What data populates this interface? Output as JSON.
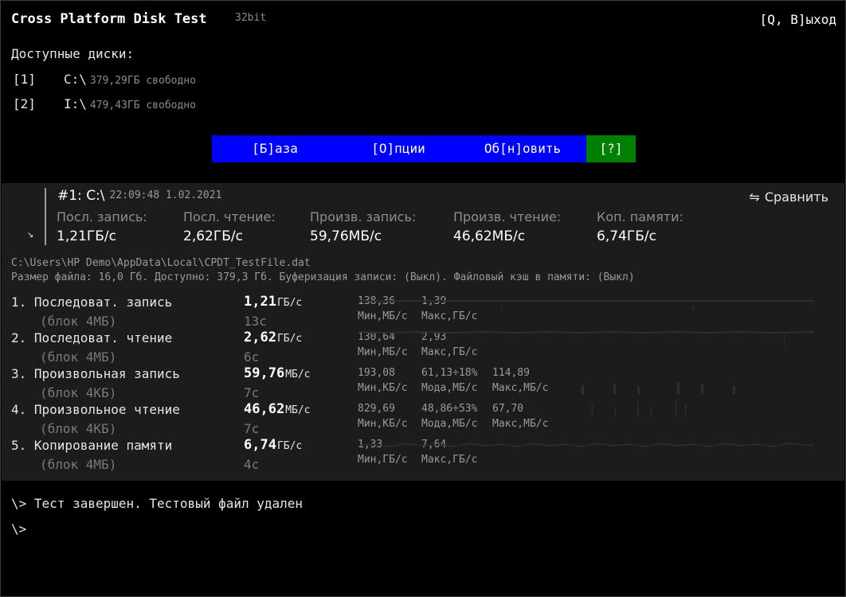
{
  "header": {
    "title": "Cross Platform Disk Test",
    "bits": "32bit",
    "quit": "[Q, В]ыход"
  },
  "disks": {
    "label": "Доступные диски:",
    "items": [
      {
        "key": "[1]",
        "drive": "C:\\",
        "free": "379,29ГБ свободно"
      },
      {
        "key": "[2]",
        "drive": "I:\\",
        "free": "479,43ГБ свободно"
      }
    ]
  },
  "menu": {
    "base": "[Б]аза",
    "options": "[О]пции",
    "update": "Об[н]овить",
    "help": "[?]"
  },
  "run": {
    "title": "#1: C:\\",
    "timestamp": "22:09:48 1.02.2021",
    "compare_icon": "swap-arrows-icon",
    "compare": "Сравнить",
    "arrow": "↘",
    "summary_headers": [
      "Посл. запись:",
      "Посл. чтение:",
      "Произв. запись:",
      "Произв. чтение:",
      "Коп. памяти:"
    ],
    "summary_values": [
      "1,21ГБ/с",
      "2,62ГБ/с",
      "59,76МБ/с",
      "46,62МБ/с",
      "6,74ГБ/с"
    ],
    "path": "C:\\Users\\HP Demo\\AppData\\Local\\CPDT_TestFile.dat",
    "info": "Размер файла: 16,0 Гб. Доступно: 379,3 Гб. Буферизация записи: (Выкл). Файловый кэш в памяти: (Выкл)"
  },
  "tests": [
    {
      "name": "1. Последоват. запись",
      "block": "(блок 4МБ)",
      "value": "1,21",
      "unit": "ГБ/с",
      "time": "13с",
      "stats_top": [
        "138,36",
        "1,39",
        ""
      ],
      "stats_bottom": [
        "Мин,МБ/с",
        "Макс,ГБ/с",
        ""
      ]
    },
    {
      "name": "2. Последоват. чтение",
      "block": "(блок 4МБ)",
      "value": "2,62",
      "unit": "ГБ/с",
      "time": "6с",
      "stats_top": [
        "130,64",
        "2,93",
        ""
      ],
      "stats_bottom": [
        "Мин,МБ/с",
        "Макс,ГБ/с",
        ""
      ]
    },
    {
      "name": "3. Произвольная запись",
      "block": "(блок 4КБ)",
      "value": "59,76",
      "unit": "МБ/с",
      "time": "7с",
      "stats_top": [
        "193,08",
        "61,13÷18%",
        "114,89"
      ],
      "stats_bottom": [
        "Мин,КБ/с",
        "Мода,МБ/с",
        "Макс,МБ/с"
      ]
    },
    {
      "name": "4. Произвольное чтение",
      "block": "(блок 4КБ)",
      "value": "46,62",
      "unit": "МБ/с",
      "time": "7с",
      "stats_top": [
        "829,69",
        "48,86÷53%",
        "67,70"
      ],
      "stats_bottom": [
        "Мин,КБ/с",
        "Мода,МБ/с",
        "Макс,МБ/с"
      ]
    },
    {
      "name": "5. Копирование памяти",
      "block": "(блок 4МБ)",
      "value": "6,74",
      "unit": "ГБ/с",
      "time": "4с",
      "stats_top": [
        "1,33",
        "7,64",
        ""
      ],
      "stats_bottom": [
        "Мин,ГБ/с",
        "Макс,ГБ/с",
        ""
      ]
    }
  ],
  "console": {
    "line1": "\\> Тест завершен. Тестовый файл удален",
    "line2": "\\>"
  },
  "colors": {
    "menu_bg": "#0000ff",
    "help_bg": "#008000",
    "panel_bg": "#1c1c1c"
  }
}
